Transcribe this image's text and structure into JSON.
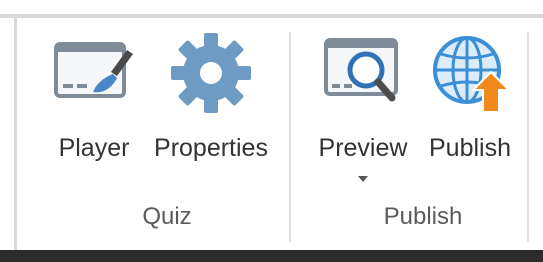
{
  "ribbon": {
    "groups": [
      {
        "label": "Quiz",
        "buttons": [
          {
            "label": "Player",
            "icon": "player-window-brush-icon"
          },
          {
            "label": "Properties",
            "icon": "gear-icon"
          }
        ]
      },
      {
        "label": "Publish",
        "buttons": [
          {
            "label": "Preview",
            "icon": "preview-magnifier-icon",
            "has_dropdown": true
          },
          {
            "label": "Publish",
            "icon": "globe-upload-icon"
          }
        ]
      }
    ]
  },
  "colors": {
    "icon_gray": "#7f8c97",
    "gear_blue": "#6e9bc3",
    "globe_blue": "#3b8fd6",
    "upload_orange": "#f08a1c",
    "brush_blue": "#4a86c8",
    "label_text": "#333333",
    "group_label_text": "#5b5b5b"
  }
}
